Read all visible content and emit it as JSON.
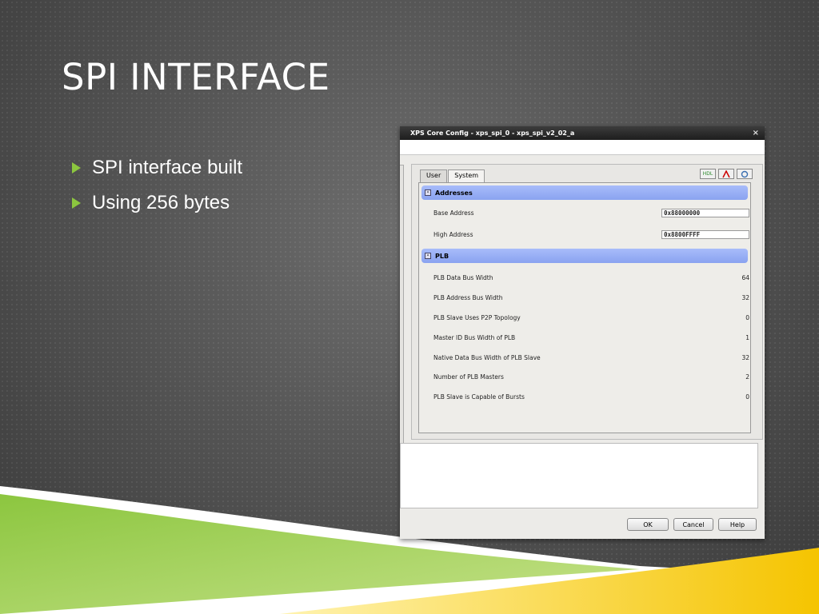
{
  "slide": {
    "title": "SPI INTERFACE",
    "bullets": [
      "SPI interface built",
      "Using 256 bytes"
    ]
  },
  "dialog": {
    "title": "XPS Core Config - xps_spi_0 - xps_spi_v2_02_a",
    "close": "×",
    "tabs": [
      "User",
      "System"
    ],
    "active_tab": "System",
    "toolbar_icons": [
      "hdl-icon",
      "pdf-icon",
      "refresh-icon"
    ],
    "hdl_label": "HDL",
    "sections": {
      "addresses": {
        "title": "Addresses",
        "rows": [
          {
            "label": "Base Address",
            "value": "0x88000000"
          },
          {
            "label": "High Address",
            "value": "0x8800FFFF"
          }
        ]
      },
      "plb": {
        "title": "PLB",
        "rows": [
          {
            "label": "PLB Data Bus Width",
            "value": "64"
          },
          {
            "label": "PLB Address Bus Width",
            "value": "32"
          },
          {
            "label": "PLB Slave Uses P2P Topology",
            "value": "0"
          },
          {
            "label": "Master ID Bus Width of PLB",
            "value": "1"
          },
          {
            "label": "Native Data Bus Width of PLB Slave",
            "value": "32"
          },
          {
            "label": "Number of PLB Masters",
            "value": "2"
          },
          {
            "label": "PLB Slave is Capable of Bursts",
            "value": "0"
          }
        ]
      }
    },
    "buttons": {
      "ok": "OK",
      "cancel": "Cancel",
      "help": "Help"
    }
  },
  "colors": {
    "accent_green": "#8cc63f",
    "accent_yellow": "#f5c400",
    "section_blue": "#8aa3f0"
  }
}
